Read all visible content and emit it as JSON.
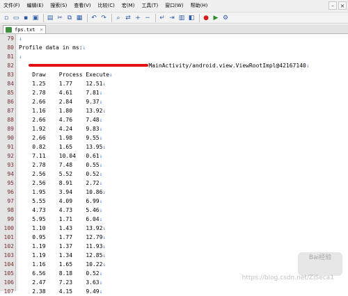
{
  "menu": [
    "文件(F)",
    "编辑(E)",
    "搜索(S)",
    "查看(V)",
    "比较(C)",
    "宏(M)",
    "工具(T)",
    "窗口(W)",
    "帮助(H)"
  ],
  "window_controls": {
    "minimize": "–",
    "close": "×"
  },
  "toolbar_icons": [
    "new-file-icon",
    "open-file-icon",
    "save-icon",
    "save-all-icon",
    "print-icon",
    "cut-icon",
    "copy-icon",
    "paste-icon",
    "undo-icon",
    "redo-icon",
    "find-icon",
    "replace-icon",
    "zoom-in-icon",
    "zoom-out-icon",
    "wrap-icon",
    "indent-icon",
    "view-icon",
    "compare-icon",
    "macro-record-icon",
    "macro-play-icon",
    "settings-icon"
  ],
  "tab": {
    "label": "fps.txt",
    "close": "×"
  },
  "eol_glyph": "↓",
  "lines": [
    {
      "num": "79",
      "text": ""
    },
    {
      "num": "80",
      "text": "Profile data in ms:"
    },
    {
      "num": "81",
      "text": ""
    },
    {
      "num": "82",
      "prefix": "   ",
      "suffix": "MainActivity/android.view.ViewRootImpl@42167140",
      "redacted": true
    },
    {
      "num": "83",
      "text": "    Draw    Process Execute"
    },
    {
      "num": "84",
      "text": "    1.25    1.77    12.51"
    },
    {
      "num": "85",
      "text": "    2.78    4.61    7.81"
    },
    {
      "num": "86",
      "text": "    2.66    2.84    9.37"
    },
    {
      "num": "87",
      "text": "    1.16    1.80    13.92"
    },
    {
      "num": "88",
      "text": "    2.66    4.76    7.48"
    },
    {
      "num": "89",
      "text": "    1.92    4.24    9.83"
    },
    {
      "num": "90",
      "text": "    2.66    1.98    9.55"
    },
    {
      "num": "91",
      "text": "    0.82    1.65    13.95"
    },
    {
      "num": "92",
      "text": "    7.11    10.04   0.61"
    },
    {
      "num": "93",
      "text": "    2.78    7.48    0.55"
    },
    {
      "num": "94",
      "text": "    2.56    5.52    0.52"
    },
    {
      "num": "95",
      "text": "    2.56    8.91    2.72"
    },
    {
      "num": "96",
      "text": "    1.95    3.94    10.86"
    },
    {
      "num": "97",
      "text": "    5.55    4.09    6.99"
    },
    {
      "num": "98",
      "text": "    4.73    4.73    5.46"
    },
    {
      "num": "99",
      "text": "    5.95    1.71    6.04"
    },
    {
      "num": "100",
      "text": "    1.10    1.43    13.92"
    },
    {
      "num": "101",
      "text": "    0.95    1.77    12.79"
    },
    {
      "num": "102",
      "text": "    1.19    1.37    11.93"
    },
    {
      "num": "103",
      "text": "    1.19    1.34    12.85"
    },
    {
      "num": "104",
      "text": "    1.16    1.65    10.22"
    },
    {
      "num": "105",
      "text": "    6.56    8.18    0.52"
    },
    {
      "num": "106",
      "text": "    2.47    7.23    3.63"
    },
    {
      "num": "107",
      "text": "    2.38    4.15    9.49"
    }
  ],
  "watermark": {
    "badge": "Bai经验",
    "text": "https://blog.csdn.net/ZiSeca1"
  }
}
